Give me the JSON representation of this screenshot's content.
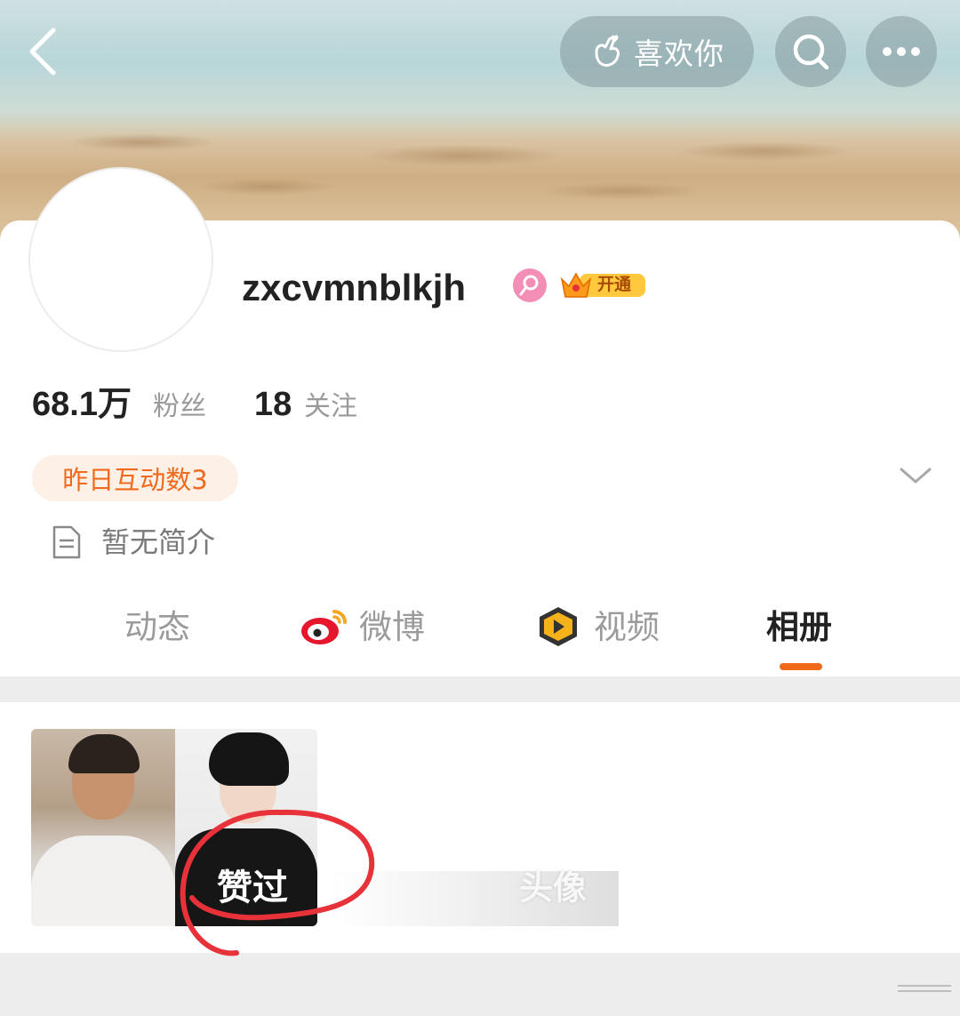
{
  "header": {
    "like_label": "喜欢你"
  },
  "profile": {
    "username": "zxcvmnblkjh",
    "vip_label": "开通",
    "followers_count": "68.1万",
    "followers_label": "粉丝",
    "following_count": "18",
    "following_label": "关注",
    "interaction_badge": "昨日互动数3",
    "bio": "暂无简介"
  },
  "tabs": [
    {
      "label": "动态",
      "active": false
    },
    {
      "label": "微博",
      "active": false
    },
    {
      "label": "视频",
      "active": false
    },
    {
      "label": "相册",
      "active": true
    }
  ],
  "album": {
    "liked_label": "赞过",
    "avatar_label": "头像"
  },
  "colors": {
    "accent": "#f06a1d",
    "badge_text": "#ef6a1c",
    "badge_bg": "#fdf0e7",
    "annotation_red": "#e8323a",
    "gender_pink": "#f38fb6"
  },
  "icons": {
    "back": "chevron-left-icon",
    "like": "hand-heart-icon",
    "search": "search-icon",
    "more": "more-icon",
    "gender": "female-icon",
    "vip": "crown-icon",
    "expand": "chevron-down-icon",
    "bio": "document-icon",
    "weibo": "weibo-logo-icon",
    "video": "video-play-icon"
  }
}
